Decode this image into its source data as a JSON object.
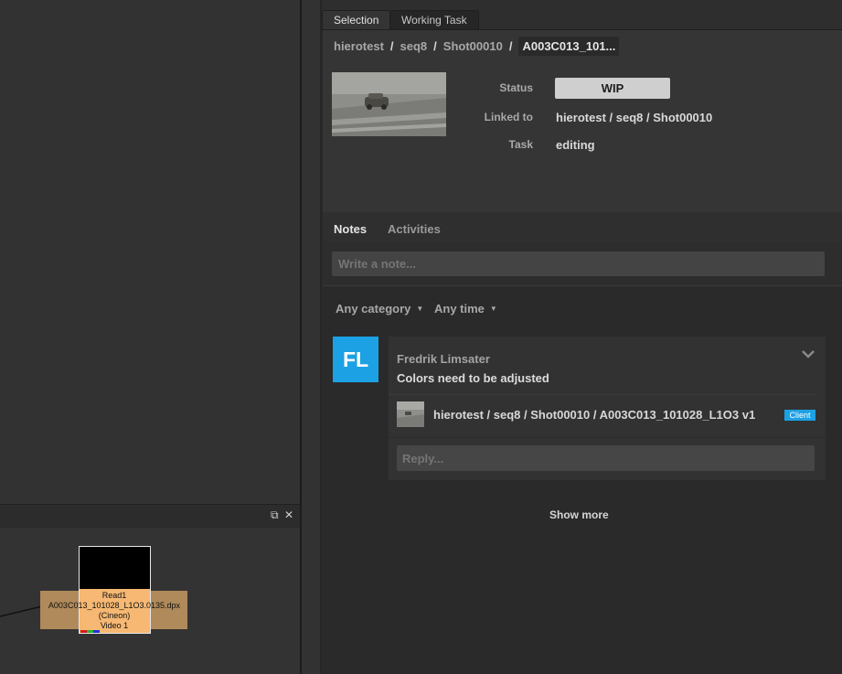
{
  "tabs": [
    {
      "label": "Selection",
      "active": true
    },
    {
      "label": "Working Task",
      "active": false
    }
  ],
  "breadcrumb": {
    "items": [
      "hierotest",
      "seq8",
      "Shot00010"
    ],
    "separator": "/",
    "current": "A003C013_101..."
  },
  "details": {
    "status_label": "Status",
    "status_value": "WIP",
    "linked_label": "Linked to",
    "linked_value": "hierotest / seq8 / Shot00010",
    "task_label": "Task",
    "task_value": "editing"
  },
  "notes_tabs": [
    "Notes",
    "Activities"
  ],
  "note_input": {
    "placeholder": "Write a note..."
  },
  "filters": {
    "category": "Any category",
    "time": "Any time"
  },
  "note": {
    "avatar_initials": "FL",
    "author": "Fredrik Limsater",
    "text": "Colors need to be adjusted",
    "attachment": "hierotest / seq8 / Shot00010 / A003C013_101028_L1O3 v1",
    "badge": "Client",
    "reply_placeholder": "Reply..."
  },
  "show_more": "Show more",
  "node": {
    "name": "Read1",
    "file": "A003C013_101028_L1O3.0135.dpx",
    "format": "(Cineon)",
    "layer": "Video 1"
  },
  "colors": {
    "accent": "#1ca1e4",
    "node_fill": "#f6b873"
  }
}
